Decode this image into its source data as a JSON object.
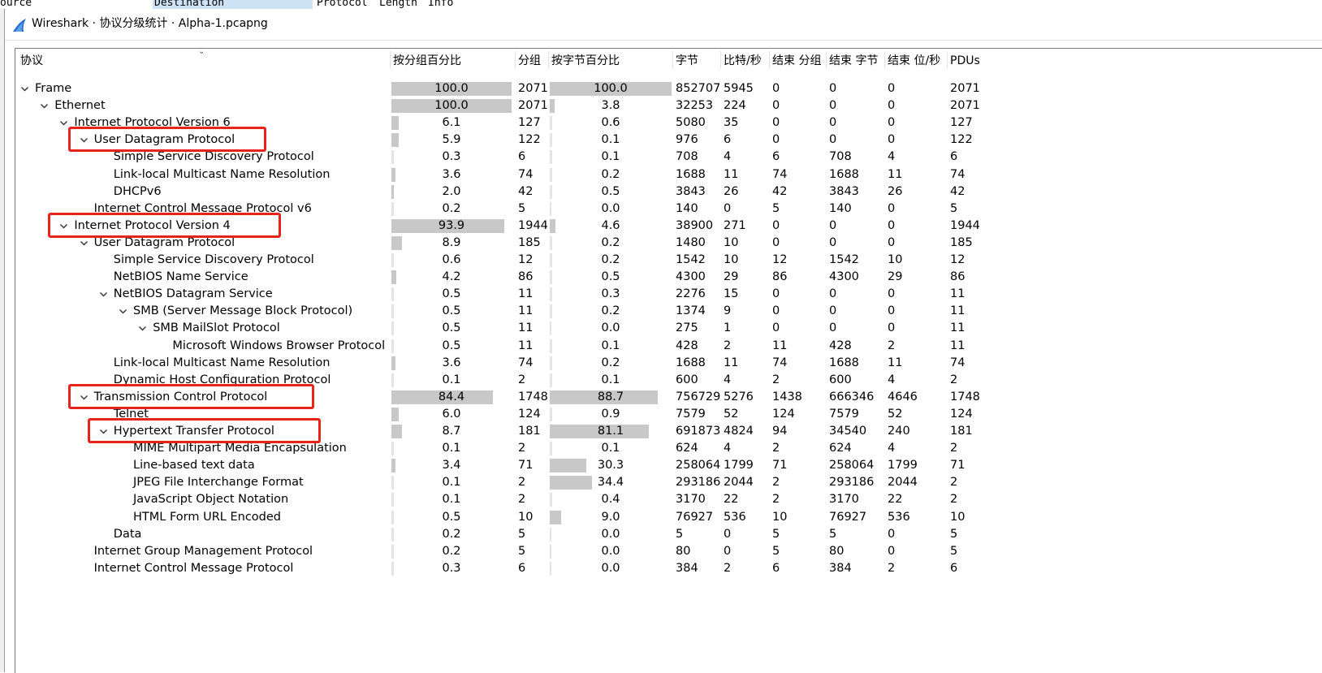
{
  "background_window": {
    "column_headers": [
      "ource",
      "Destination",
      "Protocol",
      "Length",
      "Info"
    ]
  },
  "window": {
    "title": "Wireshark · 协议分级统计 · Alpha-1.pcapng",
    "icon": "wireshark-fin-icon"
  },
  "table": {
    "columns": [
      "协议",
      "按分组百分比",
      "分组",
      "按字节百分比",
      "字节",
      "比特/秒",
      "结束 分组",
      "结束 字节",
      "结束 位/秒",
      "PDUs"
    ],
    "rows": [
      {
        "protocol": "Frame",
        "depth": 0,
        "expanded": true,
        "pct_packets": "100.0",
        "packets": "2071",
        "pct_bytes": "100.0",
        "bytes": "852707",
        "bits_per_sec": "5945",
        "end_packets": "0",
        "end_bytes": "0",
        "end_bits_per_sec": "0",
        "pdus": "2071",
        "highlighted": false
      },
      {
        "protocol": "Ethernet",
        "depth": 1,
        "expanded": true,
        "pct_packets": "100.0",
        "packets": "2071",
        "pct_bytes": "3.8",
        "bytes": "32253",
        "bits_per_sec": "224",
        "end_packets": "0",
        "end_bytes": "0",
        "end_bits_per_sec": "0",
        "pdus": "2071",
        "highlighted": false
      },
      {
        "protocol": "Internet Protocol Version 6",
        "depth": 2,
        "expanded": true,
        "pct_packets": "6.1",
        "packets": "127",
        "pct_bytes": "0.6",
        "bytes": "5080",
        "bits_per_sec": "35",
        "end_packets": "0",
        "end_bytes": "0",
        "end_bits_per_sec": "0",
        "pdus": "127",
        "highlighted": false
      },
      {
        "protocol": "User Datagram Protocol",
        "depth": 3,
        "expanded": true,
        "pct_packets": "5.9",
        "packets": "122",
        "pct_bytes": "0.1",
        "bytes": "976",
        "bits_per_sec": "6",
        "end_packets": "0",
        "end_bytes": "0",
        "end_bits_per_sec": "0",
        "pdus": "122",
        "highlighted": true
      },
      {
        "protocol": "Simple Service Discovery Protocol",
        "depth": 4,
        "expanded": null,
        "pct_packets": "0.3",
        "packets": "6",
        "pct_bytes": "0.1",
        "bytes": "708",
        "bits_per_sec": "4",
        "end_packets": "6",
        "end_bytes": "708",
        "end_bits_per_sec": "4",
        "pdus": "6",
        "highlighted": false
      },
      {
        "protocol": "Link-local Multicast Name Resolution",
        "depth": 4,
        "expanded": null,
        "pct_packets": "3.6",
        "packets": "74",
        "pct_bytes": "0.2",
        "bytes": "1688",
        "bits_per_sec": "11",
        "end_packets": "74",
        "end_bytes": "1688",
        "end_bits_per_sec": "11",
        "pdus": "74",
        "highlighted": false
      },
      {
        "protocol": "DHCPv6",
        "depth": 4,
        "expanded": null,
        "pct_packets": "2.0",
        "packets": "42",
        "pct_bytes": "0.5",
        "bytes": "3843",
        "bits_per_sec": "26",
        "end_packets": "42",
        "end_bytes": "3843",
        "end_bits_per_sec": "26",
        "pdus": "42",
        "highlighted": false
      },
      {
        "protocol": "Internet Control Message Protocol v6",
        "depth": 3,
        "expanded": null,
        "pct_packets": "0.2",
        "packets": "5",
        "pct_bytes": "0.0",
        "bytes": "140",
        "bits_per_sec": "0",
        "end_packets": "5",
        "end_bytes": "140",
        "end_bits_per_sec": "0",
        "pdus": "5",
        "highlighted": false
      },
      {
        "protocol": "Internet Protocol Version 4",
        "depth": 2,
        "expanded": true,
        "pct_packets": "93.9",
        "packets": "1944",
        "pct_bytes": "4.6",
        "bytes": "38900",
        "bits_per_sec": "271",
        "end_packets": "0",
        "end_bytes": "0",
        "end_bits_per_sec": "0",
        "pdus": "1944",
        "highlighted": true
      },
      {
        "protocol": "User Datagram Protocol",
        "depth": 3,
        "expanded": true,
        "pct_packets": "8.9",
        "packets": "185",
        "pct_bytes": "0.2",
        "bytes": "1480",
        "bits_per_sec": "10",
        "end_packets": "0",
        "end_bytes": "0",
        "end_bits_per_sec": "0",
        "pdus": "185",
        "highlighted": false
      },
      {
        "protocol": "Simple Service Discovery Protocol",
        "depth": 4,
        "expanded": null,
        "pct_packets": "0.6",
        "packets": "12",
        "pct_bytes": "0.2",
        "bytes": "1542",
        "bits_per_sec": "10",
        "end_packets": "12",
        "end_bytes": "1542",
        "end_bits_per_sec": "10",
        "pdus": "12",
        "highlighted": false
      },
      {
        "protocol": "NetBIOS Name Service",
        "depth": 4,
        "expanded": null,
        "pct_packets": "4.2",
        "packets": "86",
        "pct_bytes": "0.5",
        "bytes": "4300",
        "bits_per_sec": "29",
        "end_packets": "86",
        "end_bytes": "4300",
        "end_bits_per_sec": "29",
        "pdus": "86",
        "highlighted": false
      },
      {
        "protocol": "NetBIOS Datagram Service",
        "depth": 4,
        "expanded": true,
        "pct_packets": "0.5",
        "packets": "11",
        "pct_bytes": "0.3",
        "bytes": "2276",
        "bits_per_sec": "15",
        "end_packets": "0",
        "end_bytes": "0",
        "end_bits_per_sec": "0",
        "pdus": "11",
        "highlighted": false
      },
      {
        "protocol": "SMB (Server Message Block Protocol)",
        "depth": 5,
        "expanded": true,
        "pct_packets": "0.5",
        "packets": "11",
        "pct_bytes": "0.2",
        "bytes": "1374",
        "bits_per_sec": "9",
        "end_packets": "0",
        "end_bytes": "0",
        "end_bits_per_sec": "0",
        "pdus": "11",
        "highlighted": false
      },
      {
        "protocol": "SMB MailSlot Protocol",
        "depth": 6,
        "expanded": true,
        "pct_packets": "0.5",
        "packets": "11",
        "pct_bytes": "0.0",
        "bytes": "275",
        "bits_per_sec": "1",
        "end_packets": "0",
        "end_bytes": "0",
        "end_bits_per_sec": "0",
        "pdus": "11",
        "highlighted": false
      },
      {
        "protocol": "Microsoft Windows Browser Protocol",
        "depth": 7,
        "expanded": null,
        "pct_packets": "0.5",
        "packets": "11",
        "pct_bytes": "0.1",
        "bytes": "428",
        "bits_per_sec": "2",
        "end_packets": "11",
        "end_bytes": "428",
        "end_bits_per_sec": "2",
        "pdus": "11",
        "highlighted": false
      },
      {
        "protocol": "Link-local Multicast Name Resolution",
        "depth": 4,
        "expanded": null,
        "pct_packets": "3.6",
        "packets": "74",
        "pct_bytes": "0.2",
        "bytes": "1688",
        "bits_per_sec": "11",
        "end_packets": "74",
        "end_bytes": "1688",
        "end_bits_per_sec": "11",
        "pdus": "74",
        "highlighted": false
      },
      {
        "protocol": "Dynamic Host Configuration Protocol",
        "depth": 4,
        "expanded": null,
        "pct_packets": "0.1",
        "packets": "2",
        "pct_bytes": "0.1",
        "bytes": "600",
        "bits_per_sec": "4",
        "end_packets": "2",
        "end_bytes": "600",
        "end_bits_per_sec": "4",
        "pdus": "2",
        "highlighted": false
      },
      {
        "protocol": "Transmission Control Protocol",
        "depth": 3,
        "expanded": true,
        "pct_packets": "84.4",
        "packets": "1748",
        "pct_bytes": "88.7",
        "bytes": "756729",
        "bits_per_sec": "5276",
        "end_packets": "1438",
        "end_bytes": "666346",
        "end_bits_per_sec": "4646",
        "pdus": "1748",
        "highlighted": true
      },
      {
        "protocol": "Telnet",
        "depth": 4,
        "expanded": null,
        "pct_packets": "6.0",
        "packets": "124",
        "pct_bytes": "0.9",
        "bytes": "7579",
        "bits_per_sec": "52",
        "end_packets": "124",
        "end_bytes": "7579",
        "end_bits_per_sec": "52",
        "pdus": "124",
        "highlighted": false
      },
      {
        "protocol": "Hypertext Transfer Protocol",
        "depth": 4,
        "expanded": true,
        "pct_packets": "8.7",
        "packets": "181",
        "pct_bytes": "81.1",
        "bytes": "691873",
        "bits_per_sec": "4824",
        "end_packets": "94",
        "end_bytes": "34540",
        "end_bits_per_sec": "240",
        "pdus": "181",
        "highlighted": true
      },
      {
        "protocol": "MIME Multipart Media Encapsulation",
        "depth": 5,
        "expanded": null,
        "pct_packets": "0.1",
        "packets": "2",
        "pct_bytes": "0.1",
        "bytes": "624",
        "bits_per_sec": "4",
        "end_packets": "2",
        "end_bytes": "624",
        "end_bits_per_sec": "4",
        "pdus": "2",
        "highlighted": false
      },
      {
        "protocol": "Line-based text data",
        "depth": 5,
        "expanded": null,
        "pct_packets": "3.4",
        "packets": "71",
        "pct_bytes": "30.3",
        "bytes": "258064",
        "bits_per_sec": "1799",
        "end_packets": "71",
        "end_bytes": "258064",
        "end_bits_per_sec": "1799",
        "pdus": "71",
        "highlighted": false
      },
      {
        "protocol": "JPEG File Interchange Format",
        "depth": 5,
        "expanded": null,
        "pct_packets": "0.1",
        "packets": "2",
        "pct_bytes": "34.4",
        "bytes": "293186",
        "bits_per_sec": "2044",
        "end_packets": "2",
        "end_bytes": "293186",
        "end_bits_per_sec": "2044",
        "pdus": "2",
        "highlighted": false
      },
      {
        "protocol": "JavaScript Object Notation",
        "depth": 5,
        "expanded": null,
        "pct_packets": "0.1",
        "packets": "2",
        "pct_bytes": "0.4",
        "bytes": "3170",
        "bits_per_sec": "22",
        "end_packets": "2",
        "end_bytes": "3170",
        "end_bits_per_sec": "22",
        "pdus": "2",
        "highlighted": false
      },
      {
        "protocol": "HTML Form URL Encoded",
        "depth": 5,
        "expanded": null,
        "pct_packets": "0.5",
        "packets": "10",
        "pct_bytes": "9.0",
        "bytes": "76927",
        "bits_per_sec": "536",
        "end_packets": "10",
        "end_bytes": "76927",
        "end_bits_per_sec": "536",
        "pdus": "10",
        "highlighted": false
      },
      {
        "protocol": "Data",
        "depth": 4,
        "expanded": null,
        "pct_packets": "0.2",
        "packets": "5",
        "pct_bytes": "0.0",
        "bytes": "5",
        "bits_per_sec": "0",
        "end_packets": "5",
        "end_bytes": "5",
        "end_bits_per_sec": "0",
        "pdus": "5",
        "highlighted": false
      },
      {
        "protocol": "Internet Group Management Protocol",
        "depth": 3,
        "expanded": null,
        "pct_packets": "0.2",
        "packets": "5",
        "pct_bytes": "0.0",
        "bytes": "80",
        "bits_per_sec": "0",
        "end_packets": "5",
        "end_bytes": "80",
        "end_bits_per_sec": "0",
        "pdus": "5",
        "highlighted": false
      },
      {
        "protocol": "Internet Control Message Protocol",
        "depth": 3,
        "expanded": null,
        "pct_packets": "0.3",
        "packets": "6",
        "pct_bytes": "0.0",
        "bytes": "384",
        "bits_per_sec": "2",
        "end_packets": "6",
        "end_bytes": "384",
        "end_bits_per_sec": "2",
        "pdus": "6",
        "highlighted": false
      }
    ]
  },
  "colors": {
    "bar": "#c8c8c8",
    "highlight": "#e8231a",
    "icon_blue": "#1f6fd1"
  }
}
